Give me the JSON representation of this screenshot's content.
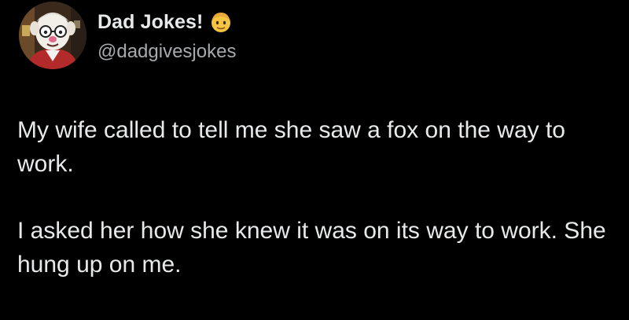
{
  "author": {
    "display_name": "Dad Jokes!",
    "handle": "@dadgivesjokes",
    "name_emoji": "man-face-emoji",
    "avatar_icon": "cartoon-dad-avatar"
  },
  "post": {
    "paragraphs": [
      "My wife called to tell me she saw a fox on the way to work.",
      "I asked her how she knew it was on its way to work. She hung up on me."
    ]
  },
  "colors": {
    "background": "#000000",
    "primary_text": "#e7e9ea",
    "secondary_text": "#a7aaad"
  }
}
